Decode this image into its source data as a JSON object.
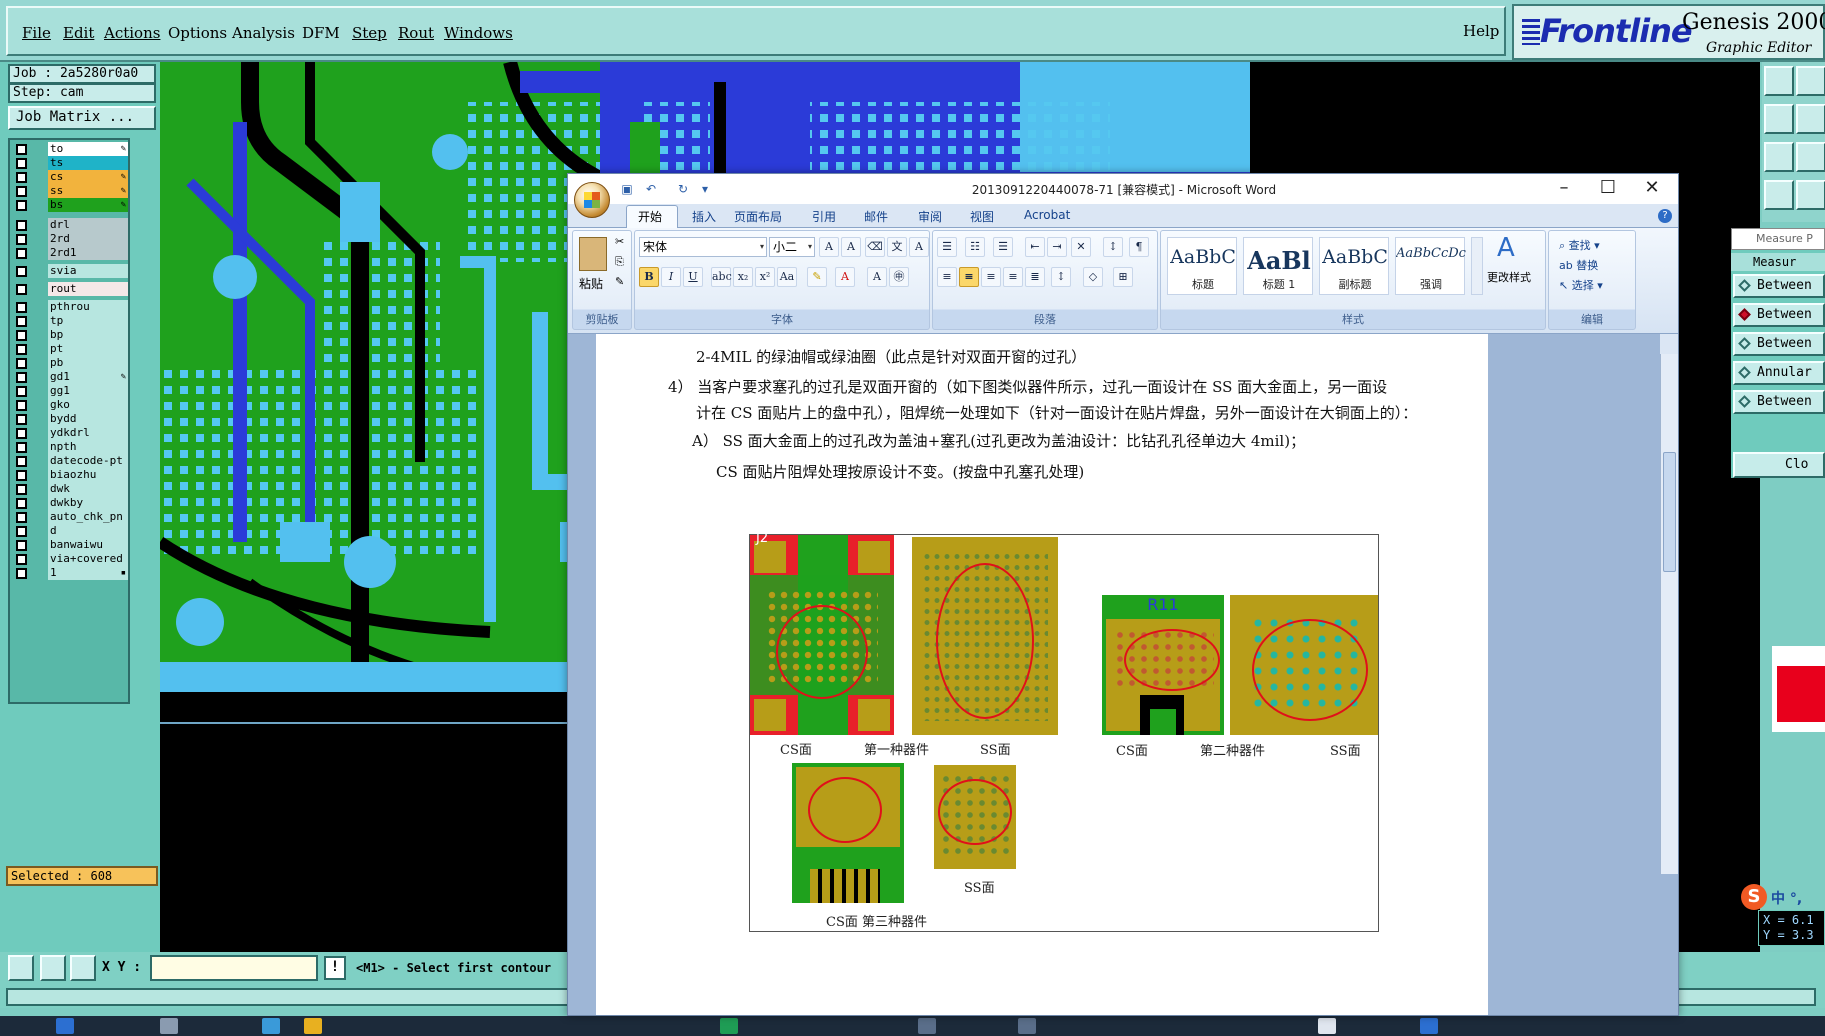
{
  "menu": {
    "items": [
      "File",
      "Edit",
      "Actions",
      "Options",
      "Analysis",
      "DFM",
      "Step",
      "Rout",
      "Windows"
    ],
    "help": "Help"
  },
  "brand": {
    "logo": "Frontline",
    "title": "Genesis 2000 ",
    "subtitle": "Graphic Editor"
  },
  "job": {
    "job_line": "Job : 2a5280r0a0",
    "step_line": "Step: cam",
    "matrix_button": "Job Matrix ..."
  },
  "layers": [
    {
      "name": "to",
      "color": "#ffffff",
      "mark": "✎"
    },
    {
      "name": "ts",
      "color": "#1fb3c8",
      "mark": ""
    },
    {
      "name": "cs",
      "color": "#f2b33d",
      "mark": "✎"
    },
    {
      "name": "ss",
      "color": "#f2b33d",
      "mark": "✎"
    },
    {
      "name": "bs",
      "color": "#1fa11d",
      "mark": "✎"
    },
    {
      "name": "drl",
      "color": "#b7c9cc",
      "mark": ""
    },
    {
      "name": "2rd",
      "color": "#b7c9cc",
      "mark": ""
    },
    {
      "name": "2rd1",
      "color": "#b7c9cc",
      "mark": ""
    },
    {
      "name": "svia",
      "color": "#b7e6e0",
      "mark": ""
    },
    {
      "name": "rout",
      "color": "#f4e8e8",
      "mark": ""
    },
    {
      "name": "pthrou",
      "color": "#b7e6e0",
      "mark": ""
    },
    {
      "name": "tp",
      "color": "#b7e6e0",
      "mark": ""
    },
    {
      "name": "bp",
      "color": "#b7e6e0",
      "mark": ""
    },
    {
      "name": "pt",
      "color": "#b7e6e0",
      "mark": ""
    },
    {
      "name": "pb",
      "color": "#b7e6e0",
      "mark": ""
    },
    {
      "name": "gd1",
      "color": "#b7e6e0",
      "mark": "✎"
    },
    {
      "name": "gg1",
      "color": "#b7e6e0",
      "mark": ""
    },
    {
      "name": "gko",
      "color": "#b7e6e0",
      "mark": ""
    },
    {
      "name": "bydd",
      "color": "#b7e6e0",
      "mark": ""
    },
    {
      "name": "ydkdrl",
      "color": "#b7e6e0",
      "mark": ""
    },
    {
      "name": "npth",
      "color": "#b7e6e0",
      "mark": ""
    },
    {
      "name": "datecode-pt",
      "color": "#b7e6e0",
      "mark": ""
    },
    {
      "name": "biaozhu",
      "color": "#b7e6e0",
      "mark": ""
    },
    {
      "name": "dwk",
      "color": "#b7e6e0",
      "mark": ""
    },
    {
      "name": "dwkby",
      "color": "#b7e6e0",
      "mark": ""
    },
    {
      "name": "auto_chk_pn",
      "color": "#b7e6e0",
      "mark": ""
    },
    {
      "name": "d",
      "color": "#b7e6e0",
      "mark": ""
    },
    {
      "name": "banwaiwu",
      "color": "#b7e6e0",
      "mark": ""
    },
    {
      "name": "via+covered",
      "color": "#b7e6e0",
      "mark": ""
    },
    {
      "name": "1",
      "color": "#b7e6e0",
      "mark": "▪"
    }
  ],
  "selected": "Selected : 608",
  "command": {
    "xy_label": "X Y :",
    "xy_value": "",
    "bang": "!",
    "hint": "<M1> - Select first contour"
  },
  "measure": {
    "window_title": "Measure P",
    "subtitle": "Measur",
    "items": [
      {
        "label": "Between",
        "active": false
      },
      {
        "label": "Between",
        "active": true
      },
      {
        "label": "Between",
        "active": false
      },
      {
        "label": "Annular",
        "active": false
      },
      {
        "label": "Between",
        "active": false
      }
    ],
    "close": "Clo"
  },
  "coords": {
    "x": "X = 6.1",
    "y": "Y = 3.3"
  },
  "ime": {
    "logo": "S",
    "text": "中 °,"
  },
  "word": {
    "caption": "2013091220440078-71 [兼容模式] - Microsoft Word",
    "tabs": [
      "开始",
      "插入",
      "页面布局",
      "引用",
      "邮件",
      "审阅",
      "视图",
      "Acrobat"
    ],
    "font_name": "宋体",
    "font_size": "小二",
    "groups": {
      "clipboard": "剪贴板",
      "font": "字体",
      "paragraph": "段落",
      "styles": "样式",
      "edit": "编辑"
    },
    "paste": "粘贴",
    "styles": [
      {
        "preview": "AaBbC",
        "label": "标题",
        "size": "19px",
        "bold": false
      },
      {
        "preview": "AaBl",
        "label": "标题 1",
        "size": "24px",
        "bold": true
      },
      {
        "preview": "AaBbC",
        "label": "副标题",
        "size": "19px",
        "bold": false
      },
      {
        "preview": "AaBbCcDc",
        "label": "强调",
        "size": "13px",
        "bold": false
      }
    ],
    "change_styles": "更改样式",
    "edit_buttons": [
      "查找 ▾",
      "替换",
      "选择 ▾"
    ],
    "doc_lines": [
      "2-4MIL 的绿油帽或绿油圈（此点是针对双面开窗的过孔）",
      "4）    当客户要求塞孔的过孔是双面开窗的（如下图类似器件所示，过孔一面设计在 SS 面大金面上，另一面设",
      "计在 CS 面贴片上的盘中孔），阻焊统一处理如下（针对一面设计在贴片焊盘，另外一面设计在大铜面上的）：",
      "A） SS 面大金面上的过孔改为盖油+塞孔(过孔更改为盖油设计：比钻孔孔径单边大 4mil)；",
      "CS 面贴片阻焊处理按原设计不变。(按盘中孔塞孔处理)"
    ],
    "figure": {
      "label_j2": "J2",
      "label_r11": "R11",
      "captions": [
        "CS面",
        "第一种器件",
        "SS面",
        "CS面",
        "第二种器件",
        "SS面",
        "SS面",
        "CS面  第三种器件"
      ]
    }
  }
}
